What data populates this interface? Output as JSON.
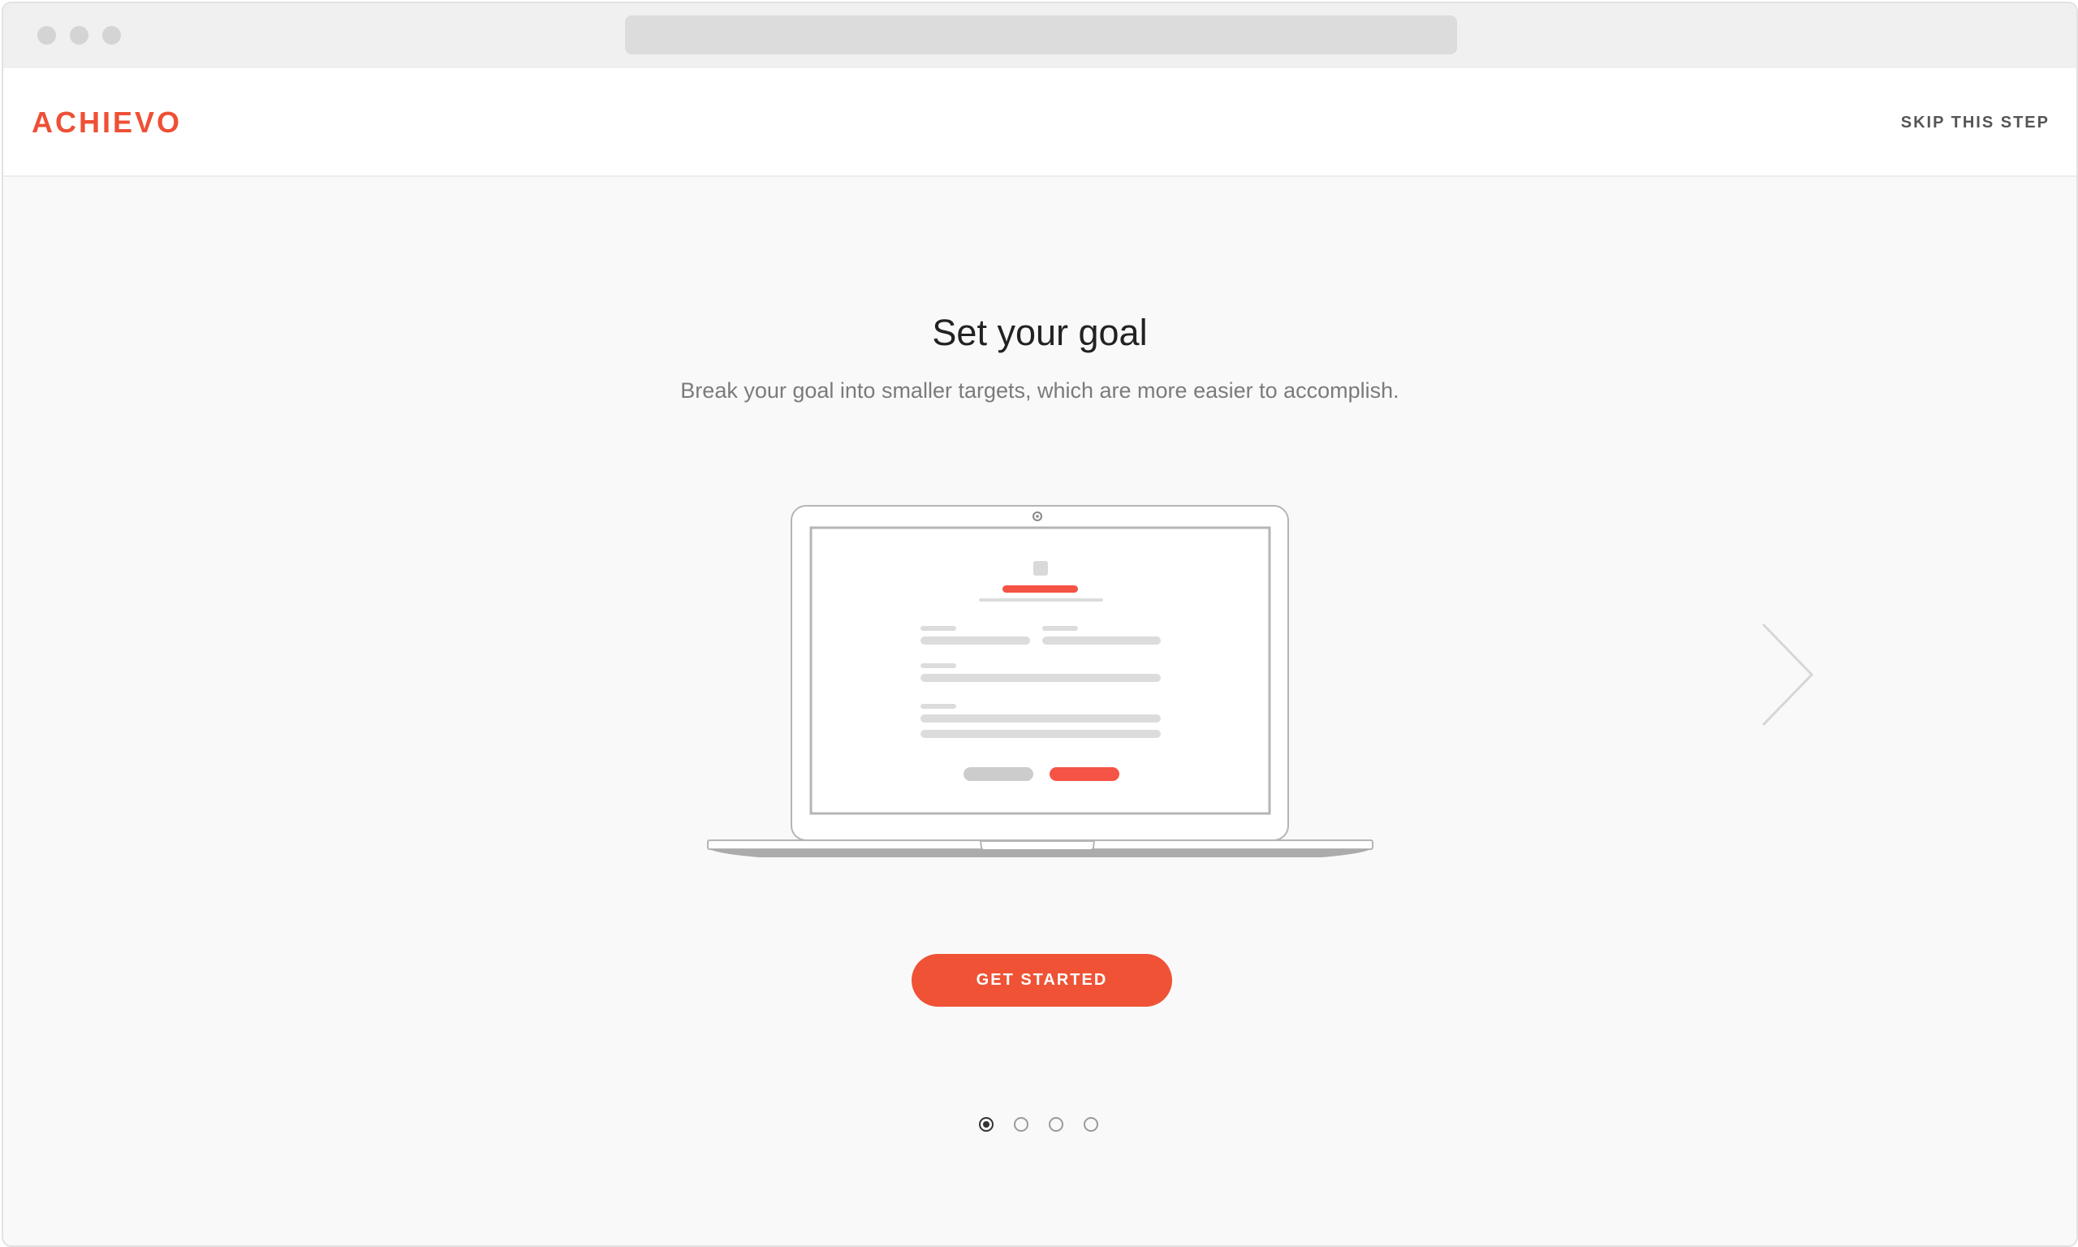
{
  "header": {
    "logo": "ACHIEVO",
    "skip_label": "SKIP THIS STEP"
  },
  "onboarding": {
    "title": "Set your goal",
    "subtitle": "Break your goal into smaller targets, which are more easier to accomplish.",
    "cta_label": "GET STARTED",
    "illustration": "laptop-form-illustration",
    "next_icon": "chevron-right-icon"
  },
  "pagination": {
    "total": 4,
    "active_index": 0
  },
  "colors": {
    "brand": "#ee5035",
    "background": "#f9f9f9",
    "text_primary": "#222222",
    "text_secondary": "#7b7b7b"
  }
}
